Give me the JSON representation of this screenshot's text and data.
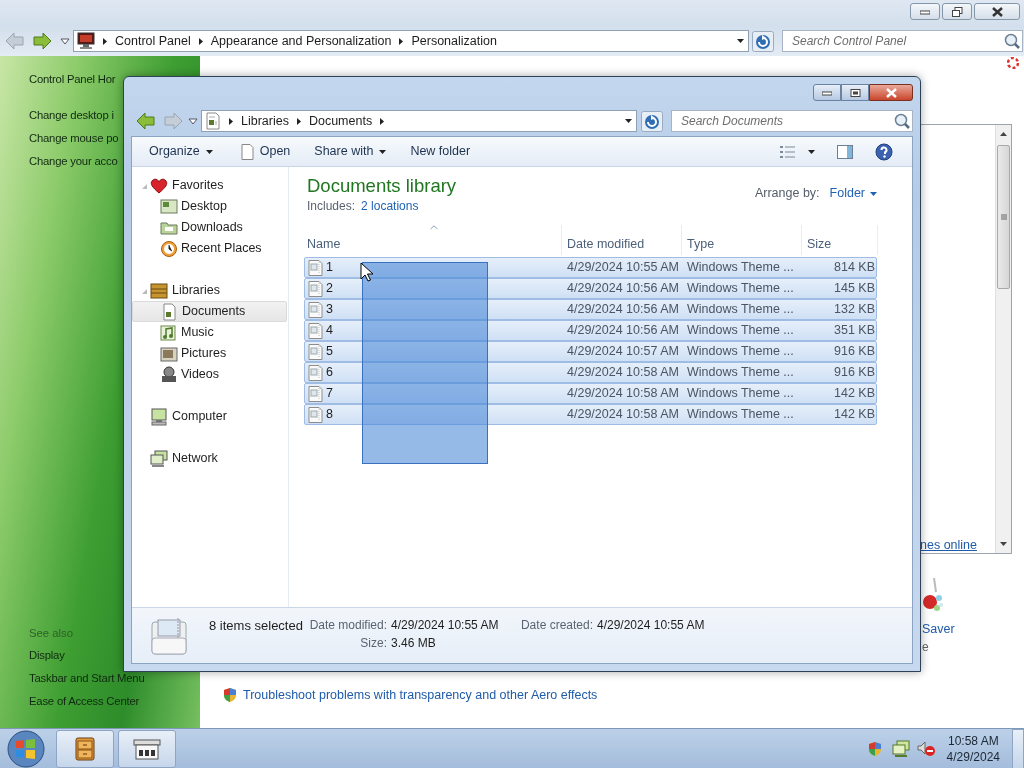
{
  "control_panel": {
    "breadcrumb": [
      "Control Panel",
      "Appearance and Personalization",
      "Personalization"
    ],
    "search": {
      "placeholder": "Search Control Panel"
    },
    "sidebar": {
      "home_link": "Control Panel Hor",
      "tasks": [
        "Change desktop i",
        "Change mouse po",
        "Change your acco"
      ],
      "see_also_heading": "See also",
      "see_also": [
        "Display",
        "Taskbar and Start Menu",
        "Ease of Access Center"
      ]
    },
    "themes_link": "nes online",
    "screen_saver_label": "Saver",
    "screen_saver_value": "e",
    "troubleshoot_link": "Troubleshoot problems with transparency and other Aero effects"
  },
  "explorer": {
    "breadcrumb": [
      "Libraries",
      "Documents"
    ],
    "search": {
      "placeholder": "Search Documents"
    },
    "toolbar": [
      {
        "label": "Organize",
        "kind": "menu"
      },
      {
        "label": "Open",
        "kind": "open"
      },
      {
        "label": "Share with",
        "kind": "menu"
      },
      {
        "label": "New folder",
        "kind": "plain"
      }
    ],
    "nav_pane": [
      {
        "label": "Favorites",
        "selected": false,
        "expanded": true,
        "children": [
          {
            "label": "Desktop",
            "selected": false
          },
          {
            "label": "Downloads",
            "selected": false
          },
          {
            "label": "Recent Places",
            "selected": false
          }
        ]
      },
      {
        "label": "Libraries",
        "selected": false,
        "expanded": true,
        "children": [
          {
            "label": "Documents",
            "selected": true
          },
          {
            "label": "Music",
            "selected": false
          },
          {
            "label": "Pictures",
            "selected": false
          },
          {
            "label": "Videos",
            "selected": false
          }
        ]
      },
      {
        "label": "Computer",
        "selected": false
      },
      {
        "label": "Network",
        "selected": false
      }
    ],
    "library_title": "Documents library",
    "includes_label": "Includes:",
    "includes_link": "2 locations",
    "arrange_label": "Arrange by:",
    "arrange_value": "Folder",
    "columns": [
      "Name",
      "Date modified",
      "Type",
      "Size"
    ],
    "rows": [
      {
        "name": "1",
        "date": "4/29/2024 10:55 AM",
        "type": "Windows Theme ...",
        "size": "814 KB",
        "selected": true
      },
      {
        "name": "2",
        "date": "4/29/2024 10:56 AM",
        "type": "Windows Theme ...",
        "size": "145 KB",
        "selected": true
      },
      {
        "name": "3",
        "date": "4/29/2024 10:56 AM",
        "type": "Windows Theme ...",
        "size": "132 KB",
        "selected": true
      },
      {
        "name": "4",
        "date": "4/29/2024 10:56 AM",
        "type": "Windows Theme ...",
        "size": "351 KB",
        "selected": true
      },
      {
        "name": "5",
        "date": "4/29/2024 10:57 AM",
        "type": "Windows Theme ...",
        "size": "916 KB",
        "selected": true
      },
      {
        "name": "6",
        "date": "4/29/2024 10:58 AM",
        "type": "Windows Theme ...",
        "size": "916 KB",
        "selected": true
      },
      {
        "name": "7",
        "date": "4/29/2024 10:58 AM",
        "type": "Windows Theme ...",
        "size": "142 KB",
        "selected": true
      },
      {
        "name": "8",
        "date": "4/29/2024 10:58 AM",
        "type": "Windows Theme ...",
        "size": "142 KB",
        "selected": true
      }
    ],
    "details": {
      "summary": "8 items selected",
      "modified_label": "Date modified:",
      "modified": "4/29/2024 10:55 AM",
      "created_label": "Date created:",
      "created": "4/29/2024 10:55 AM",
      "size_label": "Size:",
      "size": "3.46 MB"
    }
  },
  "taskbar": {
    "clock_time": "10:58 AM",
    "clock_date": "4/29/2024"
  }
}
